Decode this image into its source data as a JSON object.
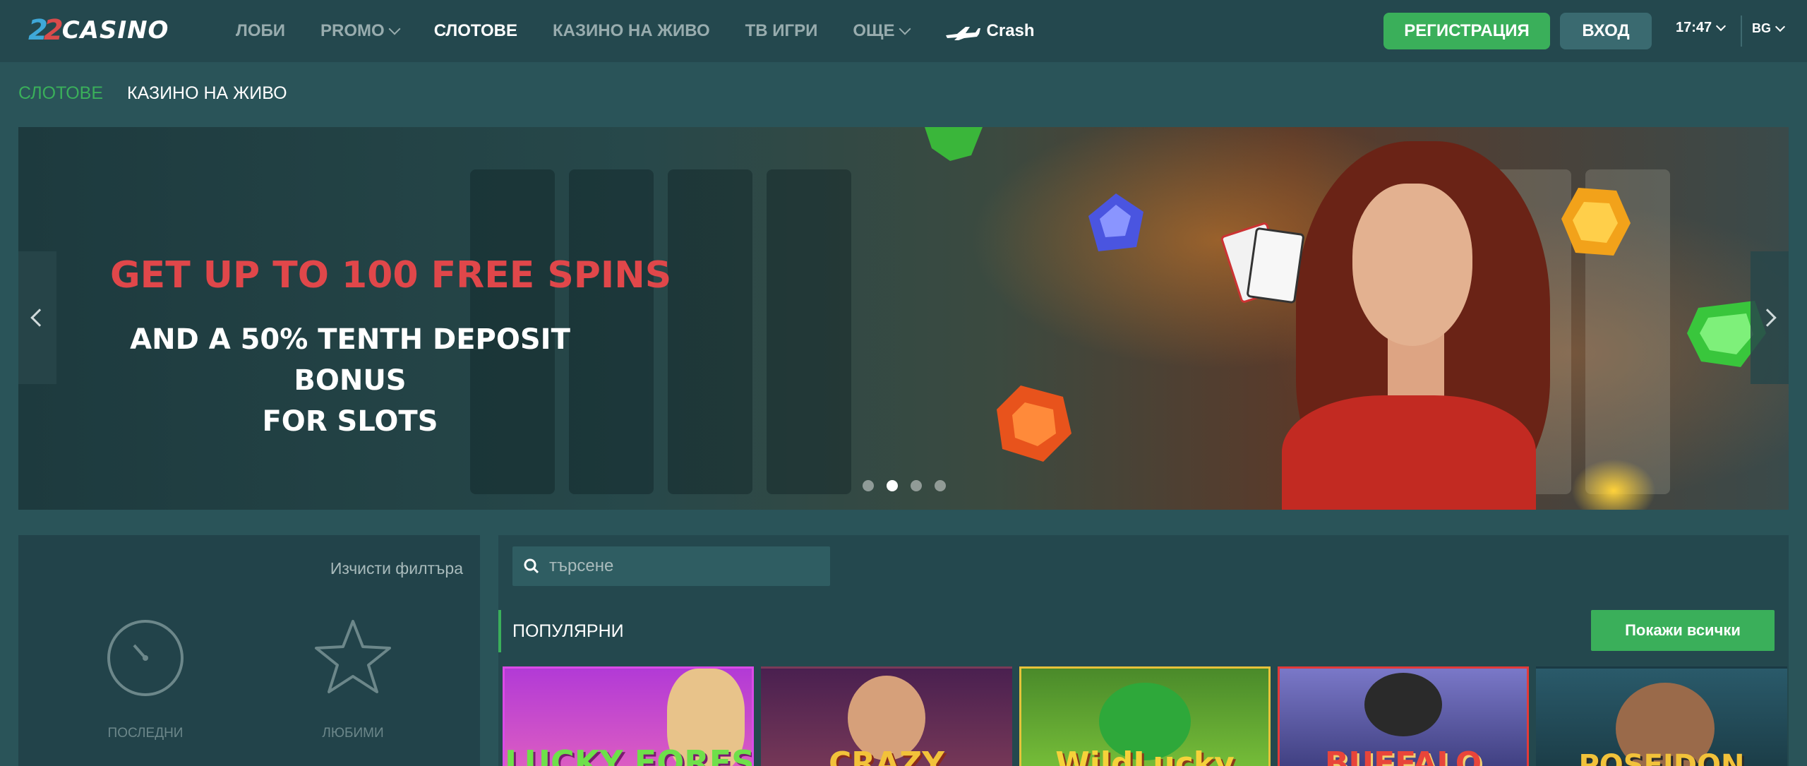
{
  "header": {
    "logo_num": [
      "2",
      "2"
    ],
    "logo_word": "CASINO",
    "nav": [
      {
        "label": "ЛОБИ"
      },
      {
        "label": "PROMO"
      },
      {
        "label": "СЛОТОВЕ"
      },
      {
        "label": "КАЗИНО НА ЖИВО"
      },
      {
        "label": "ТВ ИГРИ"
      },
      {
        "label": "ОЩЕ"
      },
      {
        "label": "Crash"
      }
    ],
    "register_label": "РЕГИСТРАЦИЯ",
    "login_label": "ВХОД",
    "time": "17:47",
    "language": "BG"
  },
  "subnav": {
    "slots": "СЛОТОВЕ",
    "live": "КАЗИНО НА ЖИВО"
  },
  "banner": {
    "headline": "GET UP TO 100 FREE SPINS",
    "line1": "AND A 50% TENTH DEPOSIT BONUS",
    "line2": "FOR SLOTS",
    "slides": 4,
    "active_slide": 2
  },
  "filter": {
    "clear_label": "Изчисти филтъра",
    "options": [
      {
        "label": "ПОСЛЕДНИ",
        "icon": "timer-icon"
      },
      {
        "label": "ЛЮБИМИ",
        "icon": "star-icon"
      }
    ]
  },
  "games": {
    "search_placeholder": "търсене",
    "section_title": "ПОПУЛЯРНИ",
    "show_all_label": "Покажи всички",
    "tiles": [
      {
        "name": "LUCKY FOREST",
        "color": "#c93fbf",
        "border": "#d94be6"
      },
      {
        "name": "CRAZY",
        "color": "#5a2a63",
        "border": "#5a2a63"
      },
      {
        "name": "WildLucky",
        "color": "#5fa232",
        "border": "#e7c23a"
      },
      {
        "name": "BUFFALO",
        "color": "#6b5aa8",
        "border": "#e33a3a"
      },
      {
        "name": "POSEIDON",
        "color": "#2d6a73",
        "border": "#2d6a73"
      }
    ]
  },
  "colors": {
    "accent": "#3aaf5a",
    "header_bg": "#24484e",
    "page_bg": "#2a5459",
    "banner_headline": "#e0474a"
  }
}
